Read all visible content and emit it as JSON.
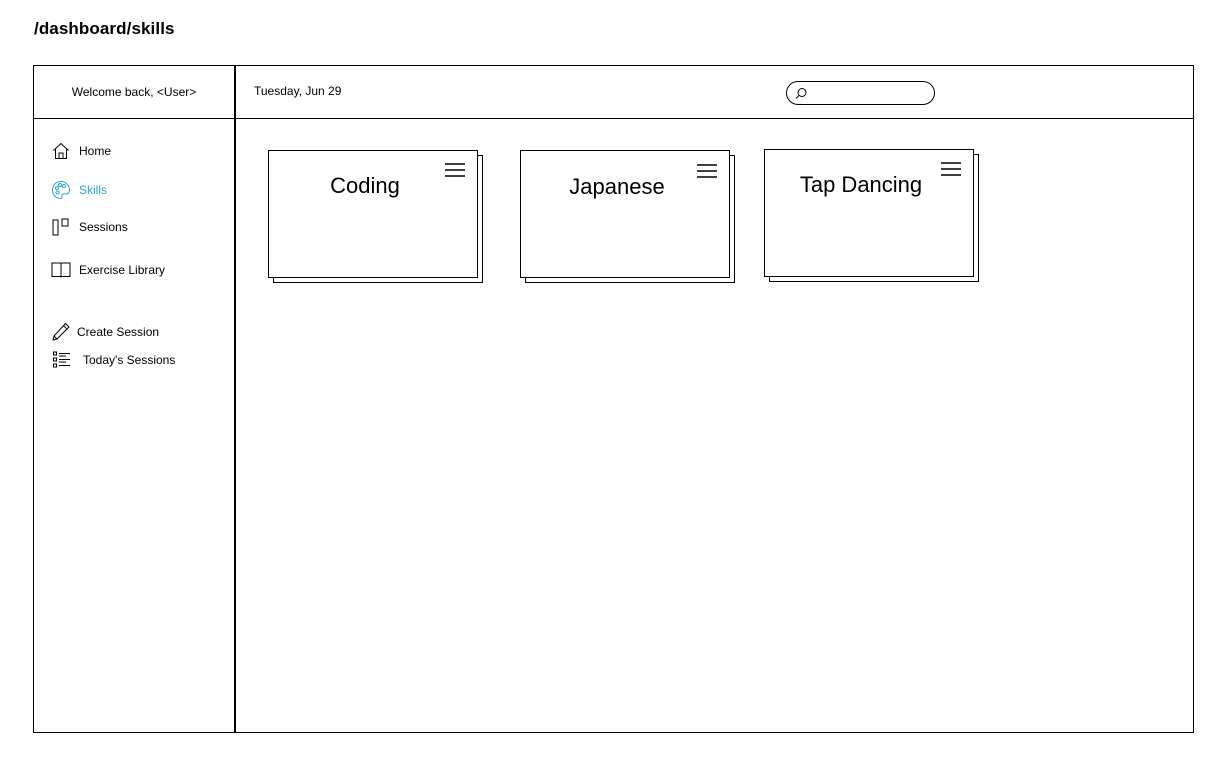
{
  "route": "/dashboard/skills",
  "sidebar": {
    "welcome": "Welcome back, <User>",
    "items": [
      {
        "label": "Home",
        "icon": "home-icon"
      },
      {
        "label": "Skills",
        "icon": "palette-icon",
        "active": true
      },
      {
        "label": "Sessions",
        "icon": "sessions-icon"
      },
      {
        "label": "Exercise Library",
        "icon": "book-icon"
      },
      {
        "label": "Create Session",
        "icon": "pencil-icon"
      },
      {
        "label": "Today's Sessions",
        "icon": "checklist-icon"
      }
    ]
  },
  "header": {
    "date": "Tuesday, Jun 29",
    "search": {
      "placeholder": "",
      "value": ""
    }
  },
  "skills": [
    {
      "title": "Coding"
    },
    {
      "title": "Japanese"
    },
    {
      "title": "Tap Dancing"
    }
  ],
  "colors": {
    "accent": "#2aa8c8",
    "border": "#000000",
    "background": "#ffffff"
  }
}
